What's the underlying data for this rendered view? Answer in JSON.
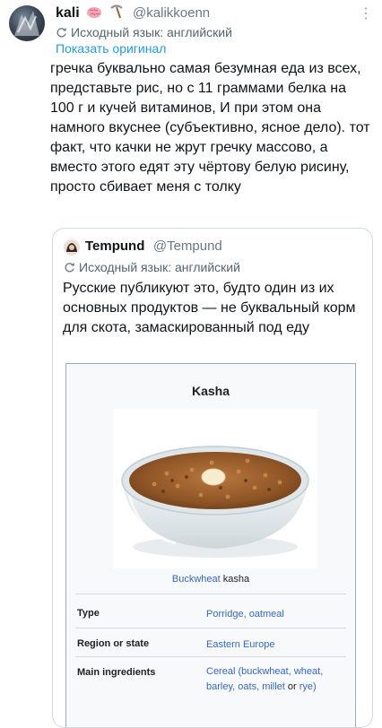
{
  "tweet": {
    "author_name": "kali",
    "author_handle": "@kalikkoenn",
    "translation_note": "Исходный язык: английский",
    "show_original": "Показать оригинал",
    "text": "гречка буквально самая безумная еда из всех, представьте рис, но с 11 граммами белка на 100 г и кучей витаминов, И при этом она намного вкуснее (субъективно, ясное дело). тот факт, что качки не жрут гречку массово, а вместо этого едят эту чёртову белую рисину, просто сбивает меня с толку",
    "icons": [
      "brain-emoji-icon",
      "pickaxe-emoji-icon",
      "more-icon",
      "translate-icon"
    ]
  },
  "quote": {
    "author_name": "Tempund",
    "author_handle": "@Tempund",
    "translation_note": "Исходный язык: английский",
    "text": "Русские публикуют это, будто один из их основных продуктов — не буквальный корм для скота, замаскированный под еду"
  },
  "infobox": {
    "title": "Kasha",
    "caption_link": "Buckwheat",
    "caption_rest": " kasha",
    "rows": [
      {
        "label": "Type",
        "value": "Porridge, oatmeal"
      },
      {
        "label": "Region or state",
        "value": "Eastern Europe"
      },
      {
        "label": "Main ingredients",
        "value_parts": [
          "Cereal (",
          "buckwheat",
          ", wheat",
          ", ",
          "barley",
          ", ",
          "oats",
          ", millet",
          " or ",
          "rye",
          ")"
        ]
      }
    ]
  },
  "colors": {
    "link": "#1d9bf0",
    "wiki_link": "#3366cc",
    "muted": "#536471"
  }
}
